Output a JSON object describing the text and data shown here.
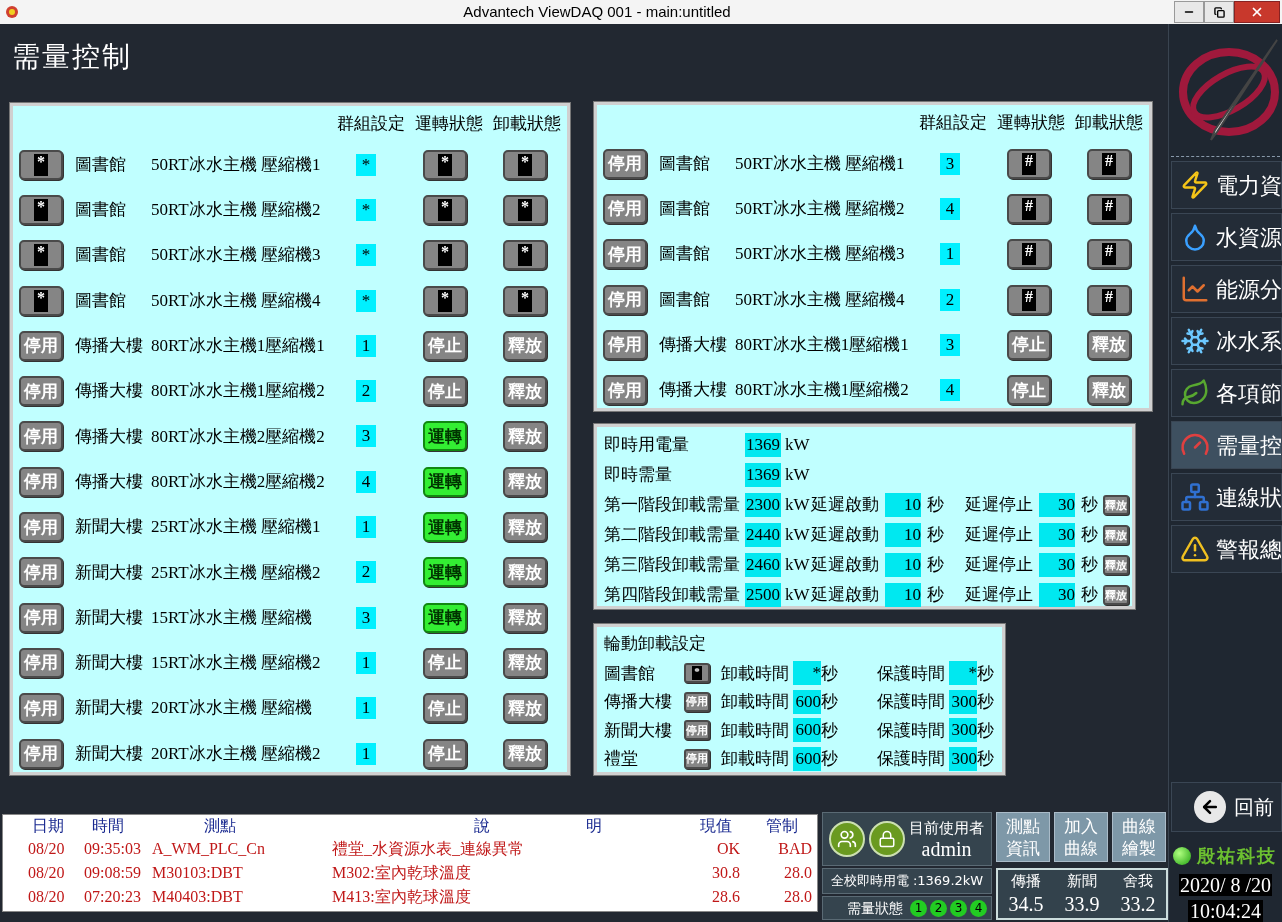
{
  "window": {
    "title": "Advantech ViewDAQ 001 - main:untitled"
  },
  "page_title": "需量控制",
  "left_panel": {
    "headers": [
      "群組設定",
      "運轉狀態",
      "卸載狀態"
    ],
    "rows": [
      {
        "disable": {
          "overlay": "*"
        },
        "building": "圖書館",
        "unit": "50RT冰水主機 壓縮機1",
        "group": "*",
        "run": {
          "overlay": "*",
          "running": false
        },
        "unload": {
          "overlay": "*"
        }
      },
      {
        "disable": {
          "overlay": "*"
        },
        "building": "圖書館",
        "unit": "50RT冰水主機 壓縮機2",
        "group": "*",
        "run": {
          "overlay": "*",
          "running": false
        },
        "unload": {
          "overlay": "*"
        }
      },
      {
        "disable": {
          "overlay": "*"
        },
        "building": "圖書館",
        "unit": "50RT冰水主機 壓縮機3",
        "group": "*",
        "run": {
          "overlay": "*",
          "running": false
        },
        "unload": {
          "overlay": "*"
        }
      },
      {
        "disable": {
          "overlay": "*"
        },
        "building": "圖書館",
        "unit": "50RT冰水主機 壓縮機4",
        "group": "*",
        "run": {
          "overlay": "*",
          "running": false
        },
        "unload": {
          "overlay": "*"
        }
      },
      {
        "disable": {
          "label": "停用"
        },
        "building": "傳播大樓",
        "unit": "80RT冰水主機1壓縮機1",
        "group": "1",
        "run": {
          "label": "停止",
          "running": false
        },
        "unload": {
          "label": "釋放"
        }
      },
      {
        "disable": {
          "label": "停用"
        },
        "building": "傳播大樓",
        "unit": "80RT冰水主機1壓縮機2",
        "group": "2",
        "run": {
          "label": "停止",
          "running": false
        },
        "unload": {
          "label": "釋放"
        }
      },
      {
        "disable": {
          "label": "停用"
        },
        "building": "傳播大樓",
        "unit": "80RT冰水主機2壓縮機2",
        "group": "3",
        "run": {
          "label": "運轉",
          "running": true
        },
        "unload": {
          "label": "釋放"
        }
      },
      {
        "disable": {
          "label": "停用"
        },
        "building": "傳播大樓",
        "unit": "80RT冰水主機2壓縮機2",
        "group": "4",
        "run": {
          "label": "運轉",
          "running": true
        },
        "unload": {
          "label": "釋放"
        }
      },
      {
        "disable": {
          "label": "停用"
        },
        "building": "新聞大樓",
        "unit": "25RT冰水主機 壓縮機1",
        "group": "1",
        "run": {
          "label": "運轉",
          "running": true
        },
        "unload": {
          "label": "釋放"
        }
      },
      {
        "disable": {
          "label": "停用"
        },
        "building": "新聞大樓",
        "unit": "25RT冰水主機 壓縮機2",
        "group": "2",
        "run": {
          "label": "運轉",
          "running": true
        },
        "unload": {
          "label": "釋放"
        }
      },
      {
        "disable": {
          "label": "停用"
        },
        "building": "新聞大樓",
        "unit": "15RT冰水主機 壓縮機",
        "group": "3",
        "run": {
          "label": "運轉",
          "running": true
        },
        "unload": {
          "label": "釋放"
        }
      },
      {
        "disable": {
          "label": "停用"
        },
        "building": "新聞大樓",
        "unit": "15RT冰水主機 壓縮機2",
        "group": "1",
        "run": {
          "label": "停止",
          "running": false
        },
        "unload": {
          "label": "釋放"
        }
      },
      {
        "disable": {
          "label": "停用"
        },
        "building": "新聞大樓",
        "unit": "20RT冰水主機 壓縮機",
        "group": "1",
        "run": {
          "label": "停止",
          "running": false
        },
        "unload": {
          "label": "釋放"
        }
      },
      {
        "disable": {
          "label": "停用"
        },
        "building": "新聞大樓",
        "unit": "20RT冰水主機 壓縮機2",
        "group": "1",
        "run": {
          "label": "停止",
          "running": false
        },
        "unload": {
          "label": "釋放"
        }
      }
    ]
  },
  "right_panel": {
    "headers": [
      "群組設定",
      "運轉狀態",
      "卸載狀態"
    ],
    "rows": [
      {
        "disable": {
          "label": "停用"
        },
        "building": "圖書館",
        "unit": "50RT冰水主機 壓縮機1",
        "group": "3",
        "run": {
          "overlay": "#",
          "running": false
        },
        "unload": {
          "overlay": "#"
        }
      },
      {
        "disable": {
          "label": "停用"
        },
        "building": "圖書館",
        "unit": "50RT冰水主機 壓縮機2",
        "group": "4",
        "run": {
          "overlay": "#",
          "running": false
        },
        "unload": {
          "overlay": "#"
        }
      },
      {
        "disable": {
          "label": "停用"
        },
        "building": "圖書館",
        "unit": "50RT冰水主機 壓縮機3",
        "group": "1",
        "run": {
          "overlay": "#",
          "running": false
        },
        "unload": {
          "overlay": "#"
        }
      },
      {
        "disable": {
          "label": "停用"
        },
        "building": "圖書館",
        "unit": "50RT冰水主機 壓縮機4",
        "group": "2",
        "run": {
          "overlay": "#",
          "running": false
        },
        "unload": {
          "overlay": "#"
        }
      },
      {
        "disable": {
          "label": "停用"
        },
        "building": "傳播大樓",
        "unit": "80RT冰水主機1壓縮機1",
        "group": "3",
        "run": {
          "label": "停止",
          "running": false
        },
        "unload": {
          "label": "釋放"
        }
      },
      {
        "disable": {
          "label": "停用"
        },
        "building": "傳播大樓",
        "unit": "80RT冰水主機1壓縮機2",
        "group": "4",
        "run": {
          "label": "停止",
          "running": false
        },
        "unload": {
          "label": "釋放"
        }
      }
    ]
  },
  "demand_panel": {
    "rows": [
      {
        "kind": "reading",
        "label": "即時用電量",
        "value": "1369",
        "unit": "kW"
      },
      {
        "kind": "reading",
        "label": "即時需量",
        "value": "1369",
        "unit": "kW"
      },
      {
        "kind": "stage",
        "label": "第一階段卸載需量",
        "value": "2300",
        "unit": "kW",
        "start_label": "延遲啟動",
        "start_value": "10",
        "start_unit": "秒",
        "stop_label": "延遲停止",
        "stop_value": "30",
        "stop_unit": "秒",
        "button": "釋放"
      },
      {
        "kind": "stage",
        "label": "第二階段卸載需量",
        "value": "2440",
        "unit": "kW",
        "start_label": "延遲啟動",
        "start_value": "10",
        "start_unit": "秒",
        "stop_label": "延遲停止",
        "stop_value": "30",
        "stop_unit": "秒",
        "button": "釋放"
      },
      {
        "kind": "stage",
        "label": "第三階段卸載需量",
        "value": "2460",
        "unit": "kW",
        "start_label": "延遲啟動",
        "start_value": "10",
        "start_unit": "秒",
        "stop_label": "延遲停止",
        "stop_value": "30",
        "stop_unit": "秒",
        "button": "釋放"
      },
      {
        "kind": "stage",
        "label": "第四階段卸載需量",
        "value": "2500",
        "unit": "kW",
        "start_label": "延遲啟動",
        "start_value": "10",
        "start_unit": "秒",
        "stop_label": "延遲停止",
        "stop_value": "30",
        "stop_unit": "秒",
        "button": "釋放"
      }
    ]
  },
  "rotation_panel": {
    "title": "輪動卸載設定",
    "rows": [
      {
        "building": "圖書館",
        "button": {
          "overlay": "*"
        },
        "unload_label": "卸載時間",
        "unload_value": "*",
        "unload_unit": "秒",
        "protect_label": "保護時間",
        "protect_value": "*",
        "protect_unit": "秒"
      },
      {
        "building": "傳播大樓",
        "button": {
          "label": "停用"
        },
        "unload_label": "卸載時間",
        "unload_value": "600",
        "unload_unit": "秒",
        "protect_label": "保護時間",
        "protect_value": "300",
        "protect_unit": "秒"
      },
      {
        "building": "新聞大樓",
        "button": {
          "label": "停用"
        },
        "unload_label": "卸載時間",
        "unload_value": "600",
        "unload_unit": "秒",
        "protect_label": "保護時間",
        "protect_value": "300",
        "protect_unit": "秒"
      },
      {
        "building": "禮堂",
        "button": {
          "label": "停用"
        },
        "unload_label": "卸載時間",
        "unload_value": "600",
        "unload_unit": "秒",
        "protect_label": "保護時間",
        "protect_value": "300",
        "protect_unit": "秒"
      }
    ]
  },
  "alarm_table": {
    "columns": [
      "日期",
      "時間",
      "測點",
      "說　　　　　　明",
      "現值",
      "管制"
    ],
    "rows": [
      [
        "08/20",
        "09:35:03",
        "A_WM_PLC_Cn",
        "禮堂_水資源水表_連線異常",
        "OK",
        "BAD"
      ],
      [
        "08/20",
        "09:08:59",
        "M30103:DBT",
        "M302:室內乾球溫度",
        "30.8",
        "28.0"
      ],
      [
        "08/20",
        "07:20:23",
        "M40403:DBT",
        "M413:室內乾球溫度",
        "28.6",
        "28.0"
      ]
    ]
  },
  "user_panel": {
    "label": "目前使用者",
    "user": "admin"
  },
  "campus_power": "全校即時用電 :1369.2kW",
  "demand_status": {
    "label": "需量狀態",
    "lights": [
      {
        "label": "1",
        "on": true
      },
      {
        "label": "2",
        "on": true
      },
      {
        "label": "3",
        "on": true
      },
      {
        "label": "4",
        "on": true
      }
    ]
  },
  "tool_buttons": [
    [
      "測點",
      "資訊"
    ],
    [
      "加入",
      "曲線"
    ],
    [
      "曲線",
      "繪製"
    ]
  ],
  "temperatures": [
    {
      "name": "傳播",
      "value": "34.5"
    },
    {
      "name": "新聞",
      "value": "33.9"
    },
    {
      "name": "舍我",
      "value": "33.2"
    }
  ],
  "sidebar": {
    "items": [
      {
        "label": "電力資",
        "selected": false
      },
      {
        "label": "水資源",
        "selected": false
      },
      {
        "label": "能源分",
        "selected": false
      },
      {
        "label": "冰水系",
        "selected": false
      },
      {
        "label": "各項節",
        "selected": false
      },
      {
        "label": "需量控",
        "selected": true
      },
      {
        "label": "連線狀",
        "selected": false
      },
      {
        "label": "警報總",
        "selected": false
      }
    ],
    "back": "回前"
  },
  "company": "殷祐科技",
  "date": "2020/ 8 /20",
  "time": "10:04:24"
}
